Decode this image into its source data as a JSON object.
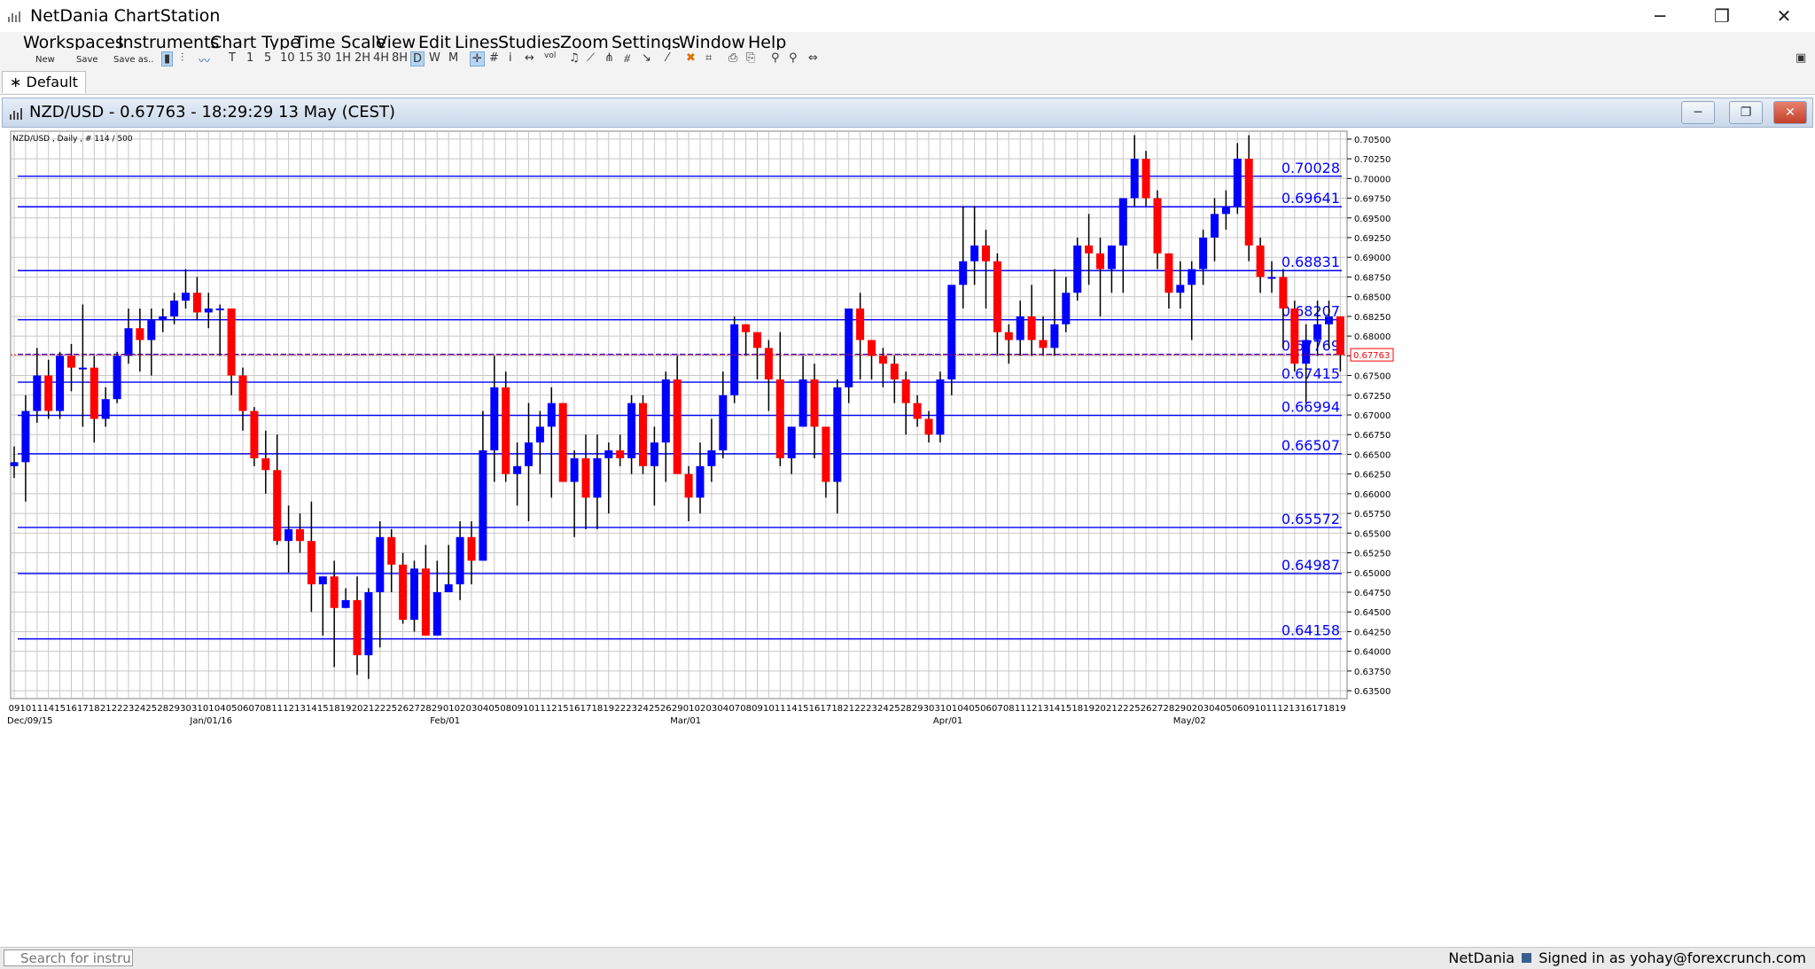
{
  "app": {
    "title": "NetDania ChartStation"
  },
  "window_controls": {
    "minimize": "─",
    "maximize": "❐",
    "close": "✕"
  },
  "menu": [
    "Workspaces",
    "Instruments",
    "Chart Type",
    "Time Scale",
    "View",
    "Edit",
    "Lines",
    "Studies",
    "Zoom",
    "Settings",
    "Window",
    "Help"
  ],
  "toolbar": {
    "new": "New",
    "save": "Save",
    "save_as": "Save as..",
    "timeframes": [
      "T",
      "1",
      "5",
      "10",
      "15",
      "30",
      "1H",
      "2H",
      "4H",
      "8H",
      "D",
      "W",
      "M"
    ],
    "active_timeframe": "D"
  },
  "tab": {
    "label": "∗ Default"
  },
  "chart_window": {
    "title": "NZD/USD - 0.67763 - 18:29:29  13 May (CEST)"
  },
  "status": {
    "search_placeholder": "Search for instrun",
    "brand": "NetDania",
    "signed_in": "Signed in as yohay@forexcrunch.com"
  },
  "chart_data": {
    "type": "candlestick",
    "info_label": "NZD/USD , Daily , # 114 / 500",
    "symbol": "NZD/USD",
    "current_price": 0.67763,
    "current_price_label": "0.67763",
    "ylim": [
      0.634,
      0.706
    ],
    "grid": true,
    "colors": {
      "up": "#0000ff",
      "down": "#ff0000",
      "lines": "#0000ff",
      "grid": "#c8c8c8"
    },
    "y_ticks": [
      "0.70500",
      "0.70250",
      "0.70000",
      "0.69750",
      "0.69500",
      "0.69250",
      "0.69000",
      "0.68750",
      "0.68500",
      "0.68250",
      "0.68000",
      "0.67750",
      "0.67500",
      "0.67250",
      "0.67000",
      "0.66750",
      "0.66500",
      "0.66250",
      "0.66000",
      "0.65750",
      "0.65500",
      "0.65250",
      "0.65000",
      "0.64750",
      "0.64500",
      "0.64250",
      "0.64000",
      "0.63750",
      "0.63500"
    ],
    "x_labels": [
      "09",
      "10",
      "11",
      "14",
      "15",
      "16",
      "17",
      "18",
      "21",
      "22",
      "23",
      "24",
      "25",
      "28",
      "29",
      "30",
      "31",
      "01",
      "04",
      "05",
      "06",
      "07",
      "08",
      "11",
      "12",
      "13",
      "14",
      "15",
      "18",
      "19",
      "20",
      "21",
      "22",
      "25",
      "26",
      "27",
      "28",
      "29",
      "01",
      "02",
      "03",
      "04",
      "05",
      "08",
      "09",
      "10",
      "11",
      "12",
      "15",
      "16",
      "17",
      "18",
      "19",
      "22",
      "23",
      "24",
      "25",
      "26",
      "29",
      "01",
      "02",
      "03",
      "04",
      "07",
      "08",
      "09",
      "10",
      "11",
      "14",
      "15",
      "16",
      "17",
      "18",
      "21",
      "22",
      "23",
      "24",
      "25",
      "28",
      "29",
      "30",
      "31",
      "01",
      "04",
      "05",
      "06",
      "07",
      "08",
      "11",
      "12",
      "13",
      "14",
      "15",
      "18",
      "19",
      "20",
      "21",
      "22",
      "25",
      "26",
      "27",
      "28",
      "29",
      "02",
      "03",
      "04",
      "05",
      "06",
      "09",
      "10",
      "11",
      "12",
      "13",
      "16",
      "17",
      "18",
      "19",
      "20",
      "23",
      "24",
      "25"
    ],
    "month_labels": [
      {
        "label": "Dec/09/15",
        "index": 0
      },
      {
        "label": "Jan/01/16",
        "index": 16
      },
      {
        "label": "Feb/01",
        "index": 37
      },
      {
        "label": "Mar/01",
        "index": 58
      },
      {
        "label": "Apr/01",
        "index": 81
      },
      {
        "label": "May/02",
        "index": 102
      }
    ],
    "levels": [
      {
        "value": 0.70028,
        "label": "0.70028"
      },
      {
        "value": 0.69641,
        "label": "0.69641"
      },
      {
        "value": 0.68831,
        "label": "0.68831"
      },
      {
        "value": 0.68207,
        "label": "0.68207"
      },
      {
        "value": 0.67769,
        "label": "0.67769"
      },
      {
        "value": 0.67415,
        "label": "0.67415"
      },
      {
        "value": 0.66994,
        "label": "0.66994"
      },
      {
        "value": 0.66507,
        "label": "0.66507"
      },
      {
        "value": 0.65572,
        "label": "0.65572"
      },
      {
        "value": 0.64987,
        "label": "0.64987"
      },
      {
        "value": 0.64158,
        "label": "0.64158"
      }
    ],
    "candles": [
      [
        0.6635,
        0.666,
        0.662,
        0.664
      ],
      [
        0.664,
        0.6725,
        0.659,
        0.6705
      ],
      [
        0.6705,
        0.6785,
        0.669,
        0.675
      ],
      [
        0.675,
        0.677,
        0.6695,
        0.6705
      ],
      [
        0.6705,
        0.678,
        0.6695,
        0.6775
      ],
      [
        0.6775,
        0.679,
        0.673,
        0.676
      ],
      [
        0.676,
        0.684,
        0.6685,
        0.676
      ],
      [
        0.676,
        0.6775,
        0.6665,
        0.6695
      ],
      [
        0.6695,
        0.6735,
        0.6685,
        0.672
      ],
      [
        0.672,
        0.678,
        0.6715,
        0.6775
      ],
      [
        0.6775,
        0.6835,
        0.6765,
        0.681
      ],
      [
        0.681,
        0.6835,
        0.6755,
        0.6795
      ],
      [
        0.6795,
        0.6835,
        0.675,
        0.682
      ],
      [
        0.682,
        0.6835,
        0.6805,
        0.6825
      ],
      [
        0.6825,
        0.6855,
        0.6815,
        0.6845
      ],
      [
        0.6845,
        0.6885,
        0.6835,
        0.6855
      ],
      [
        0.6855,
        0.6875,
        0.682,
        0.683
      ],
      [
        0.683,
        0.6855,
        0.681,
        0.6835
      ],
      [
        0.6835,
        0.684,
        0.6775,
        0.6835
      ],
      [
        0.6835,
        0.6835,
        0.6725,
        0.675
      ],
      [
        0.675,
        0.676,
        0.668,
        0.6705
      ],
      [
        0.6705,
        0.671,
        0.6635,
        0.6645
      ],
      [
        0.6645,
        0.668,
        0.66,
        0.663
      ],
      [
        0.663,
        0.6675,
        0.6535,
        0.654
      ],
      [
        0.654,
        0.6585,
        0.65,
        0.6555
      ],
      [
        0.6555,
        0.6575,
        0.6525,
        0.654
      ],
      [
        0.654,
        0.659,
        0.645,
        0.6485
      ],
      [
        0.6485,
        0.6495,
        0.642,
        0.6495
      ],
      [
        0.6495,
        0.6515,
        0.638,
        0.6455
      ],
      [
        0.6455,
        0.648,
        0.6455,
        0.6465
      ],
      [
        0.6465,
        0.6495,
        0.637,
        0.6395
      ],
      [
        0.6395,
        0.648,
        0.6365,
        0.6475
      ],
      [
        0.6475,
        0.6565,
        0.6405,
        0.6545
      ],
      [
        0.6545,
        0.6555,
        0.6475,
        0.651
      ],
      [
        0.651,
        0.6525,
        0.6435,
        0.644
      ],
      [
        0.644,
        0.6515,
        0.6425,
        0.6505
      ],
      [
        0.6505,
        0.6535,
        0.642,
        0.642
      ],
      [
        0.642,
        0.6515,
        0.642,
        0.6475
      ],
      [
        0.6475,
        0.6535,
        0.6475,
        0.6485
      ],
      [
        0.6485,
        0.6565,
        0.6465,
        0.6545
      ],
      [
        0.6545,
        0.6565,
        0.6485,
        0.6515
      ],
      [
        0.6515,
        0.6705,
        0.6515,
        0.6655
      ],
      [
        0.6655,
        0.6775,
        0.6615,
        0.6735
      ],
      [
        0.6735,
        0.6755,
        0.6615,
        0.6625
      ],
      [
        0.6625,
        0.6665,
        0.6585,
        0.6635
      ],
      [
        0.6635,
        0.6715,
        0.6565,
        0.6665
      ],
      [
        0.6665,
        0.6705,
        0.6625,
        0.6685
      ],
      [
        0.6685,
        0.6735,
        0.6595,
        0.6715
      ],
      [
        0.6715,
        0.6715,
        0.6615,
        0.6615
      ],
      [
        0.6615,
        0.6655,
        0.6545,
        0.6645
      ],
      [
        0.6645,
        0.6675,
        0.6555,
        0.6595
      ],
      [
        0.6595,
        0.6675,
        0.6555,
        0.6645
      ],
      [
        0.6645,
        0.6665,
        0.6575,
        0.6655
      ],
      [
        0.6655,
        0.6675,
        0.6635,
        0.6645
      ],
      [
        0.6645,
        0.6725,
        0.6625,
        0.6715
      ],
      [
        0.6715,
        0.6725,
        0.6625,
        0.6635
      ],
      [
        0.6635,
        0.6685,
        0.6585,
        0.6665
      ],
      [
        0.6665,
        0.6755,
        0.6615,
        0.6745
      ],
      [
        0.6745,
        0.6775,
        0.6625,
        0.6625
      ],
      [
        0.6625,
        0.6635,
        0.6565,
        0.6595
      ],
      [
        0.6595,
        0.6665,
        0.6575,
        0.6635
      ],
      [
        0.6635,
        0.6695,
        0.6615,
        0.6655
      ],
      [
        0.6655,
        0.6755,
        0.6645,
        0.6725
      ],
      [
        0.6725,
        0.6825,
        0.6715,
        0.6815
      ],
      [
        0.6815,
        0.6815,
        0.6775,
        0.6805
      ],
      [
        0.6805,
        0.6805,
        0.6745,
        0.6785
      ],
      [
        0.6785,
        0.6795,
        0.6705,
        0.6745
      ],
      [
        0.6745,
        0.6805,
        0.6635,
        0.6645
      ],
      [
        0.6645,
        0.6685,
        0.6625,
        0.6685
      ],
      [
        0.6685,
        0.6775,
        0.6685,
        0.6745
      ],
      [
        0.6745,
        0.6765,
        0.6645,
        0.6685
      ],
      [
        0.6685,
        0.6685,
        0.6595,
        0.6615
      ],
      [
        0.6615,
        0.6745,
        0.6575,
        0.6735
      ],
      [
        0.6735,
        0.6835,
        0.6715,
        0.6835
      ],
      [
        0.6835,
        0.6855,
        0.6745,
        0.6795
      ],
      [
        0.6795,
        0.6795,
        0.6745,
        0.6775
      ],
      [
        0.6775,
        0.6785,
        0.6735,
        0.6765
      ],
      [
        0.6765,
        0.6775,
        0.6715,
        0.6745
      ],
      [
        0.6745,
        0.6755,
        0.6675,
        0.6715
      ],
      [
        0.6715,
        0.6725,
        0.6685,
        0.6695
      ],
      [
        0.6695,
        0.6705,
        0.6665,
        0.6675
      ],
      [
        0.6675,
        0.6755,
        0.6665,
        0.6745
      ],
      [
        0.6745,
        0.6865,
        0.6725,
        0.6865
      ],
      [
        0.6865,
        0.6965,
        0.6835,
        0.6895
      ],
      [
        0.6895,
        0.6965,
        0.6865,
        0.6915
      ],
      [
        0.6915,
        0.6935,
        0.6835,
        0.6895
      ],
      [
        0.6895,
        0.6905,
        0.6775,
        0.6805
      ],
      [
        0.6805,
        0.6815,
        0.6765,
        0.6795
      ],
      [
        0.6795,
        0.6845,
        0.6775,
        0.6825
      ],
      [
        0.6825,
        0.6865,
        0.6775,
        0.6795
      ],
      [
        0.6795,
        0.6825,
        0.6775,
        0.6785
      ],
      [
        0.6785,
        0.6885,
        0.6775,
        0.6815
      ],
      [
        0.6815,
        0.6875,
        0.6805,
        0.6855
      ],
      [
        0.6855,
        0.6925,
        0.6845,
        0.6915
      ],
      [
        0.6915,
        0.6955,
        0.6865,
        0.6905
      ],
      [
        0.6905,
        0.6925,
        0.6825,
        0.6885
      ],
      [
        0.6885,
        0.6915,
        0.6855,
        0.6915
      ],
      [
        0.6915,
        0.6975,
        0.6855,
        0.6975
      ],
      [
        0.6975,
        0.7055,
        0.6965,
        0.7025
      ],
      [
        0.7025,
        0.7035,
        0.6965,
        0.6975
      ],
      [
        0.6975,
        0.6985,
        0.6885,
        0.6905
      ],
      [
        0.6905,
        0.6905,
        0.6835,
        0.6855
      ],
      [
        0.6855,
        0.6895,
        0.6835,
        0.6865
      ],
      [
        0.6865,
        0.6895,
        0.6795,
        0.6885
      ],
      [
        0.6885,
        0.6935,
        0.6865,
        0.6925
      ],
      [
        0.6925,
        0.6975,
        0.6895,
        0.6955
      ],
      [
        0.6955,
        0.6985,
        0.6935,
        0.6965
      ],
      [
        0.6965,
        0.7045,
        0.6955,
        0.7025
      ],
      [
        0.7025,
        0.7055,
        0.6895,
        0.6915
      ],
      [
        0.6915,
        0.6925,
        0.6855,
        0.6875
      ],
      [
        0.6875,
        0.6895,
        0.6855,
        0.6875
      ],
      [
        0.6875,
        0.6885,
        0.6785,
        0.6835
      ],
      [
        0.6835,
        0.6845,
        0.6755,
        0.6765
      ],
      [
        0.6765,
        0.6815,
        0.6715,
        0.6795
      ],
      [
        0.6795,
        0.6845,
        0.6775,
        0.6815
      ],
      [
        0.6815,
        0.6845,
        0.6785,
        0.6825
      ],
      [
        0.6825,
        0.6825,
        0.6755,
        0.6776
      ]
    ]
  }
}
